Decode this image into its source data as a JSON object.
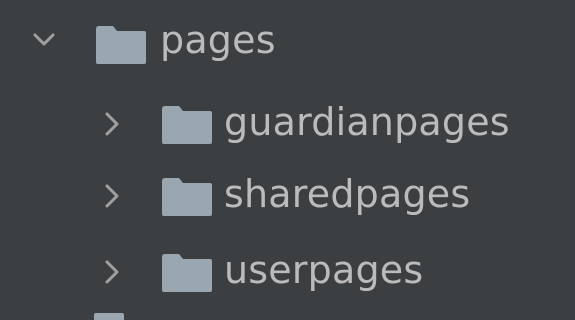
{
  "tree": {
    "root": {
      "label": "pages",
      "expanded": true,
      "icon": "folder-icon",
      "chevron": "chevron-down-icon"
    },
    "children": [
      {
        "label": "guardianpages",
        "expanded": false,
        "icon": "folder-icon",
        "chevron": "chevron-right-icon"
      },
      {
        "label": "sharedpages",
        "expanded": false,
        "icon": "folder-icon",
        "chevron": "chevron-right-icon"
      },
      {
        "label": "userpages",
        "expanded": false,
        "icon": "folder-icon",
        "chevron": "chevron-right-icon"
      }
    ]
  },
  "colors": {
    "background": "#3c3f41",
    "text": "#bbbbbb",
    "folder": "#9aa7b0",
    "chevron": "#a0a0a0"
  }
}
